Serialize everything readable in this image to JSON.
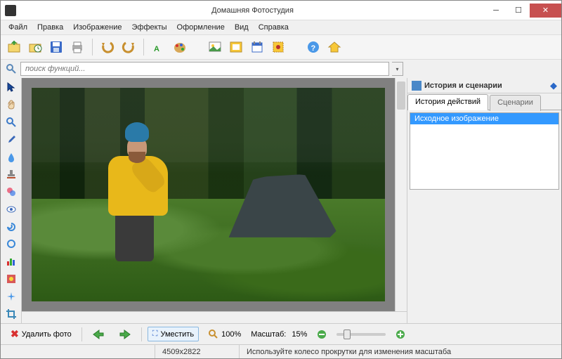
{
  "title": "Домашняя Фотостудия",
  "menu": {
    "file": "Файл",
    "edit": "Правка",
    "image": "Изображение",
    "effects": "Эффекты",
    "decoration": "Оформление",
    "view": "Вид",
    "help": "Справка"
  },
  "search": {
    "placeholder": "поиск функций..."
  },
  "panel": {
    "title": "История и сценарии",
    "tab_history": "История действий",
    "tab_scenarios": "Сценарии",
    "history_item0": "Исходное изображение"
  },
  "bottom": {
    "delete": "Удалить фото",
    "fit": "Уместить",
    "zoom100": "100%",
    "scale_label": "Масштаб:",
    "scale_value": "15%"
  },
  "status": {
    "dims": "4509x2822",
    "hint": "Используйте колесо прокрутки для изменения масштаба"
  },
  "icons": {
    "open": "open",
    "save": "save",
    "print": "print",
    "undo": "undo",
    "redo": "redo",
    "text": "text",
    "palette": "palette",
    "layer": "layer",
    "frame": "frame",
    "calendar": "calendar",
    "stamp": "stamp",
    "help": "help",
    "home": "home"
  }
}
